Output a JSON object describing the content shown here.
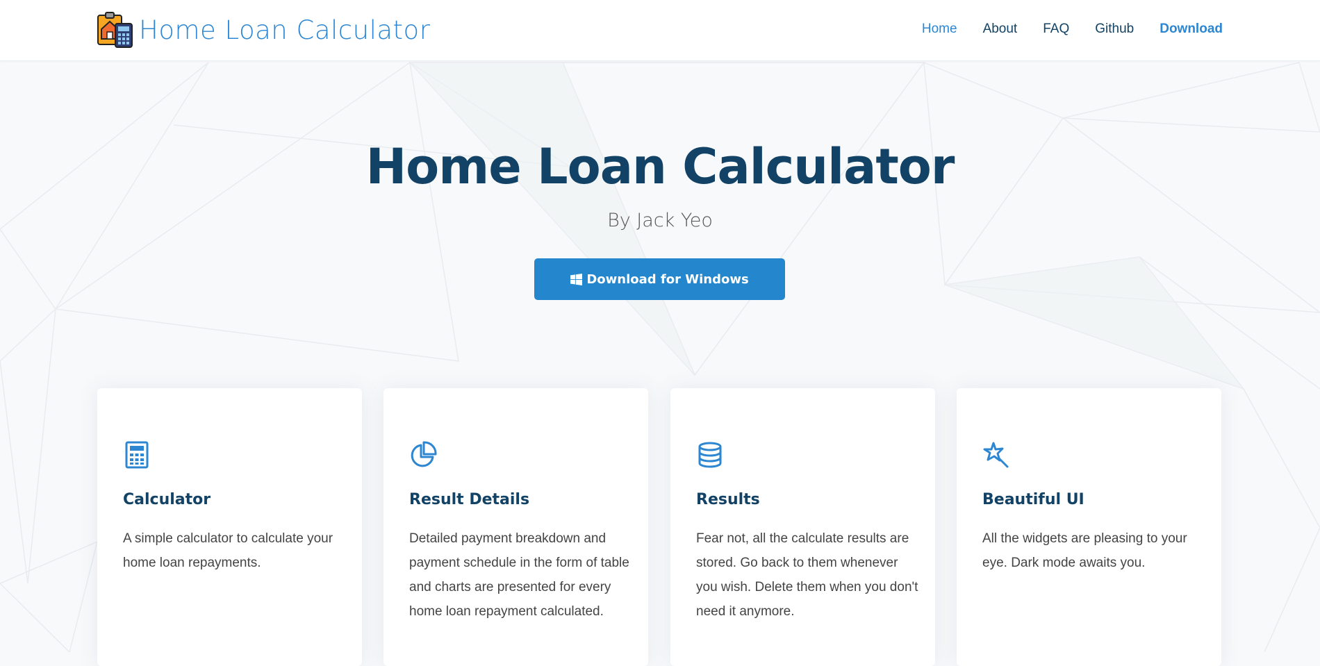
{
  "header": {
    "brand": "Home Loan Calculator",
    "nav": [
      {
        "label": "Home"
      },
      {
        "label": "About"
      },
      {
        "label": "FAQ"
      },
      {
        "label": "Github"
      },
      {
        "label": "Download"
      }
    ]
  },
  "hero": {
    "title": "Home Loan Calculator",
    "subtitle": "By Jack Yeo",
    "download_label": "Download for Windows"
  },
  "features": [
    {
      "icon": "calculator-icon",
      "title": "Calculator",
      "desc": "A simple calculator to calculate your home loan repayments."
    },
    {
      "icon": "pie-chart-icon",
      "title": "Result Details",
      "desc": "Detailed payment breakdown and payment schedule in the form of table and charts are presented for every home loan repayment calculated."
    },
    {
      "icon": "database-icon",
      "title": "Results",
      "desc": "Fear not, all the calculate results are stored. Go back to them whenever you wish. Delete them when you don't need it anymore."
    },
    {
      "icon": "magic-icon",
      "title": "Beautiful UI",
      "desc": "All the widgets are pleasing to your eye. Dark mode awaits you."
    }
  ],
  "colors": {
    "accent": "#2c86d1",
    "heading": "#124265",
    "button": "#2487ce"
  }
}
